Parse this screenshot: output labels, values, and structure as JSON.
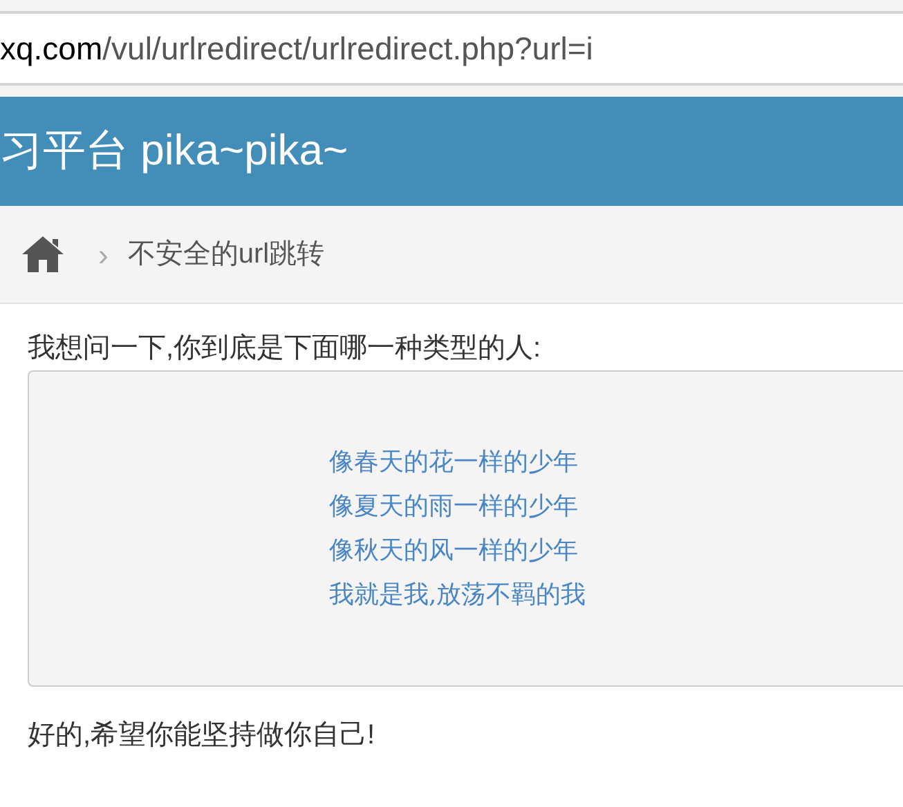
{
  "address_bar": {
    "domain": "xq.com",
    "path": "/vul/urlredirect/urlredirect.php?url=i"
  },
  "header": {
    "title": "习平台 pika~pika~"
  },
  "breadcrumb": {
    "separator": "›",
    "current": "不安全的url跳转"
  },
  "question": "我想问一下,你到底是下面哪一种类型的人:",
  "options": [
    {
      "label": "像春天的花一样的少年"
    },
    {
      "label": "像夏天的雨一样的少年"
    },
    {
      "label": "像秋天的风一样的少年"
    },
    {
      "label": "我就是我,放荡不羁的我"
    }
  ],
  "footer_text": "好的,希望你能坚持做你自己!"
}
